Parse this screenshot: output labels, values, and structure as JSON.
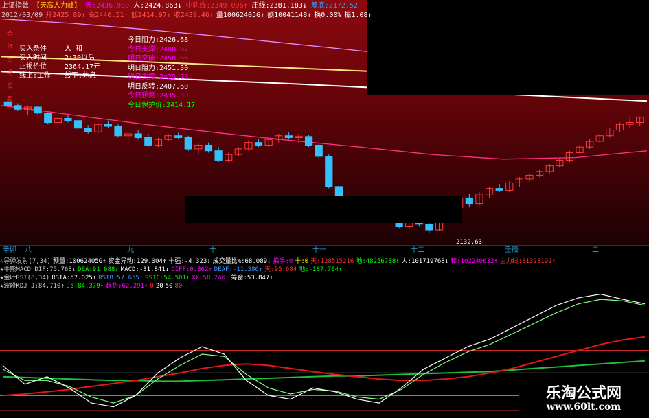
{
  "header": {
    "line1": [
      {
        "t": "上证指数",
        "c": "#ddd"
      },
      {
        "t": "【天高人为峰】",
        "c": "#fc0"
      },
      {
        "t": "天:2436.930",
        "c": "#f0f"
      },
      {
        "t": "人:2424.863↓",
        "c": "#fff"
      },
      {
        "t": "中轨线:2349.096↑",
        "c": "#f33"
      },
      {
        "t": "庄线:2381.183↓",
        "c": "#fff"
      },
      {
        "t": "筹底:2172.52",
        "c": "#39f"
      }
    ],
    "line2": [
      {
        "t": "2012/03/09",
        "c": "#ccc"
      },
      {
        "t": "开2425.89↑",
        "c": "#f55"
      },
      {
        "t": "高2440.51↑",
        "c": "#f55"
      },
      {
        "t": "低2414.97↑",
        "c": "#f55"
      },
      {
        "t": "收2439.46↑",
        "c": "#f55"
      },
      {
        "t": "量10062405G↑",
        "c": "#fff"
      },
      {
        "t": "额10041148↑",
        "c": "#fff"
      },
      {
        "t": "换0.00%",
        "c": "#fff"
      },
      {
        "t": "振1.08↑",
        "c": "#fff"
      }
    ]
  },
  "side_labels": [
    "金",
    "指",
    "出",
    "场",
    "买",
    "卖"
  ],
  "trade_box": [
    {
      "label": "买入条件",
      "value": "人  和"
    },
    {
      "label": "买入时间",
      "value": "2:30以后"
    },
    {
      "label": "止损价位",
      "value": "2364.17元"
    },
    {
      "label": "线上:工作",
      "value": "线下:休息"
    }
  ],
  "levels": [
    {
      "t": "今日阻力:2426.68",
      "c": "#fff"
    },
    {
      "t": "今日支撑:2400.92",
      "c": "#f0f"
    },
    {
      "t": "明日突破:2458.66",
      "c": "#f0f"
    },
    {
      "t": "明日阻力:2451.30",
      "c": "#fff"
    },
    {
      "t": "明日支撑:2425.78",
      "c": "#f0f"
    },
    {
      "t": "明日反转:2407.60",
      "c": "#fff"
    },
    {
      "t": "今日预测:2435.30",
      "c": "#f0f"
    },
    {
      "t": "今日保护价:2414.17",
      "c": "#0f0"
    }
  ],
  "low_label": "2132.63",
  "axis_labels": [
    "辛卯",
    "八",
    "九",
    "十",
    "十一",
    "十二",
    "壬辰",
    "二"
  ],
  "indicators": [
    [
      {
        "t": "☆导弹发射(7,34)",
        "c": "#ccc"
      },
      {
        "t": "预量:10062405G↑",
        "c": "#fff"
      },
      {
        "t": "资金异动:129.004↑",
        "c": "#fff"
      },
      {
        "t": "十强:-4.323↓",
        "c": "#fff"
      },
      {
        "t": "成交量比%:68.089↓",
        "c": "#fff"
      },
      {
        "t": "换手:0",
        "c": "#f0f"
      },
      {
        "t": "十:0",
        "c": "#ff0"
      },
      {
        "t": "天:128515216",
        "c": "#f33"
      },
      {
        "t": "地:48256788↑",
        "c": "#0f0"
      },
      {
        "t": "人:101719768↓",
        "c": "#fff"
      },
      {
        "t": "和:102240632↑",
        "c": "#f0f"
      },
      {
        "t": "主力线:81328192↑",
        "c": "#f33"
      }
    ],
    [
      {
        "t": "★牛熊MACD DIF:75.768↓",
        "c": "#ccc"
      },
      {
        "t": "DEA:91.688↓",
        "c": "#0f0"
      },
      {
        "t": "MACD:-31.841↓",
        "c": "#fff"
      },
      {
        "t": "DIFF:0.862↑",
        "c": "#f0f"
      },
      {
        "t": "DEAF:-11.386↑",
        "c": "#39f"
      },
      {
        "t": "天:95.684",
        "c": "#f33"
      },
      {
        "t": "地:-187.704↑",
        "c": "#0f0"
      }
    ],
    [
      {
        "t": "★金叶RSI(8,34)",
        "c": "#ccc"
      },
      {
        "t": "RSIA:57.025↑",
        "c": "#fff"
      },
      {
        "t": "RSIB:57.655↑",
        "c": "#39f"
      },
      {
        "t": "RSIC:54.501↑",
        "c": "#0f0"
      },
      {
        "t": "XX:58.246↑",
        "c": "#f0f"
      },
      {
        "t": "筹窗:53.847↑",
        "c": "#fff"
      }
    ],
    [
      {
        "t": "★波段KDJ J:84.710↑",
        "c": "#ccc"
      },
      {
        "t": "J5:84.379↑",
        "c": "#0f0"
      },
      {
        "t": "趋势:62.291↑",
        "c": "#f0f"
      },
      {
        "t": "0",
        "c": "#f33"
      },
      {
        "t": "20",
        "c": "#fff"
      },
      {
        "t": "50",
        "c": "#fff"
      },
      {
        "t": "80",
        "c": "#f33"
      }
    ]
  ],
  "watermark": {
    "cn": "乐淘公式网",
    "url": "www.60lt.com"
  },
  "chart_data": {
    "type": "line",
    "title": "上证指数",
    "candles": [
      [
        0,
        2480,
        2488,
        2465,
        2470
      ],
      [
        1,
        2470,
        2476,
        2455,
        2460
      ],
      [
        2,
        2460,
        2470,
        2445,
        2466
      ],
      [
        3,
        2466,
        2470,
        2445,
        2450
      ],
      [
        4,
        2450,
        2452,
        2420,
        2425
      ],
      [
        5,
        2425,
        2440,
        2415,
        2436
      ],
      [
        6,
        2436,
        2445,
        2425,
        2430
      ],
      [
        7,
        2430,
        2438,
        2405,
        2410
      ],
      [
        8,
        2410,
        2418,
        2395,
        2400
      ],
      [
        9,
        2400,
        2425,
        2395,
        2420
      ],
      [
        10,
        2420,
        2430,
        2410,
        2415
      ],
      [
        11,
        2415,
        2420,
        2385,
        2390
      ],
      [
        12,
        2390,
        2400,
        2370,
        2395
      ],
      [
        13,
        2395,
        2405,
        2380,
        2385
      ],
      [
        14,
        2385,
        2395,
        2360,
        2365
      ],
      [
        15,
        2365,
        2385,
        2360,
        2380
      ],
      [
        16,
        2380,
        2395,
        2375,
        2390
      ],
      [
        17,
        2390,
        2398,
        2380,
        2385
      ],
      [
        18,
        2385,
        2390,
        2350,
        2355
      ],
      [
        19,
        2355,
        2370,
        2340,
        2365
      ],
      [
        20,
        2365,
        2372,
        2345,
        2350
      ],
      [
        21,
        2350,
        2360,
        2320,
        2325
      ],
      [
        22,
        2325,
        2345,
        2320,
        2340
      ],
      [
        23,
        2340,
        2360,
        2335,
        2355
      ],
      [
        24,
        2355,
        2378,
        2350,
        2372
      ],
      [
        25,
        2372,
        2380,
        2360,
        2365
      ],
      [
        26,
        2365,
        2385,
        2360,
        2380
      ],
      [
        27,
        2380,
        2395,
        2372,
        2390
      ],
      [
        28,
        2390,
        2400,
        2380,
        2385
      ],
      [
        29,
        2385,
        2395,
        2370,
        2388
      ],
      [
        30,
        2388,
        2392,
        2360,
        2365
      ],
      [
        31,
        2365,
        2370,
        2330,
        2335
      ],
      [
        32,
        2335,
        2340,
        2250,
        2255
      ],
      [
        33,
        2255,
        2260,
        2200,
        2205
      ],
      [
        34,
        2205,
        2215,
        2180,
        2190
      ],
      [
        35,
        2190,
        2200,
        2170,
        2195
      ],
      [
        36,
        2195,
        2205,
        2180,
        2185
      ],
      [
        37,
        2185,
        2195,
        2160,
        2165
      ],
      [
        38,
        2165,
        2175,
        2150,
        2170
      ],
      [
        39,
        2170,
        2175,
        2145,
        2150
      ],
      [
        40,
        2150,
        2165,
        2140,
        2160
      ],
      [
        41,
        2160,
        2170,
        2150,
        2155
      ],
      [
        42,
        2155,
        2162,
        2132,
        2140
      ],
      [
        43,
        2140,
        2185,
        2138,
        2180
      ],
      [
        44,
        2180,
        2205,
        2175,
        2200
      ],
      [
        45,
        2200,
        2230,
        2195,
        2225
      ],
      [
        46,
        2225,
        2235,
        2200,
        2210
      ],
      [
        47,
        2210,
        2240,
        2205,
        2235
      ],
      [
        48,
        2235,
        2255,
        2225,
        2250
      ],
      [
        49,
        2250,
        2262,
        2240,
        2245
      ],
      [
        50,
        2245,
        2270,
        2240,
        2265
      ],
      [
        51,
        2265,
        2280,
        2255,
        2275
      ],
      [
        52,
        2275,
        2290,
        2268,
        2285
      ],
      [
        53,
        2285,
        2300,
        2280,
        2295
      ],
      [
        54,
        2295,
        2315,
        2290,
        2310
      ],
      [
        55,
        2310,
        2330,
        2305,
        2325
      ],
      [
        56,
        2325,
        2350,
        2320,
        2345
      ],
      [
        57,
        2345,
        2365,
        2340,
        2360
      ],
      [
        58,
        2360,
        2380,
        2355,
        2375
      ],
      [
        59,
        2375,
        2395,
        2370,
        2390
      ],
      [
        60,
        2390,
        2410,
        2385,
        2405
      ],
      [
        61,
        2405,
        2425,
        2400,
        2420
      ],
      [
        62,
        2420,
        2440,
        2410,
        2425
      ],
      [
        63,
        2425,
        2441,
        2415,
        2439
      ]
    ],
    "ma_lines": [
      {
        "name": "",
        "color": "#ffffff",
        "values": [
          2560,
          2553,
          2545,
          2536,
          2528,
          2519,
          2510,
          2500,
          2491,
          2482
        ]
      },
      {
        "name": "",
        "color": "#ffe680",
        "values": [
          2600,
          2593,
          2586,
          2578,
          2570,
          2562,
          2553,
          2545,
          2536,
          2527
        ]
      },
      {
        "name": "",
        "color": "#e090ff",
        "values": [
          2700,
          2688,
          2672,
          2654,
          2635,
          2615,
          2595,
          2575,
          2556,
          2538
        ]
      },
      {
        "name": "",
        "color": "#ff3380",
        "values": [
          2470,
          2445,
          2420,
          2398,
          2378,
          2360,
          2340,
          2328,
          2332,
          2350
        ]
      }
    ],
    "kdj": {
      "J": [
        60,
        35,
        45,
        30,
        10,
        5,
        20,
        50,
        70,
        85,
        75,
        40,
        20,
        15,
        30,
        25,
        15,
        10,
        30,
        55,
        70,
        85,
        95,
        110,
        125,
        140,
        150,
        155,
        148,
        142
      ],
      "D": [
        55,
        40,
        40,
        32,
        18,
        10,
        20,
        42,
        60,
        75,
        72,
        48,
        30,
        22,
        28,
        26,
        18,
        15,
        28,
        48,
        64,
        78,
        88,
        102,
        116,
        130,
        142,
        148,
        146,
        140
      ],
      "trend": [
        20,
        22,
        25,
        28,
        32,
        36,
        40,
        45,
        50,
        56,
        60,
        62,
        60,
        56,
        52,
        48,
        45,
        42,
        40,
        40,
        42,
        45,
        50,
        56,
        64,
        72,
        80,
        88,
        94,
        98
      ],
      "green": [
        45,
        44,
        43,
        42,
        41,
        40,
        40,
        39,
        39,
        40,
        41,
        42,
        43,
        44,
        45,
        46,
        46,
        47,
        48,
        49,
        50,
        51,
        52,
        54,
        56,
        58,
        60,
        62,
        64,
        66
      ]
    },
    "kdj_levels": [
      0,
      20,
      50,
      80
    ]
  }
}
